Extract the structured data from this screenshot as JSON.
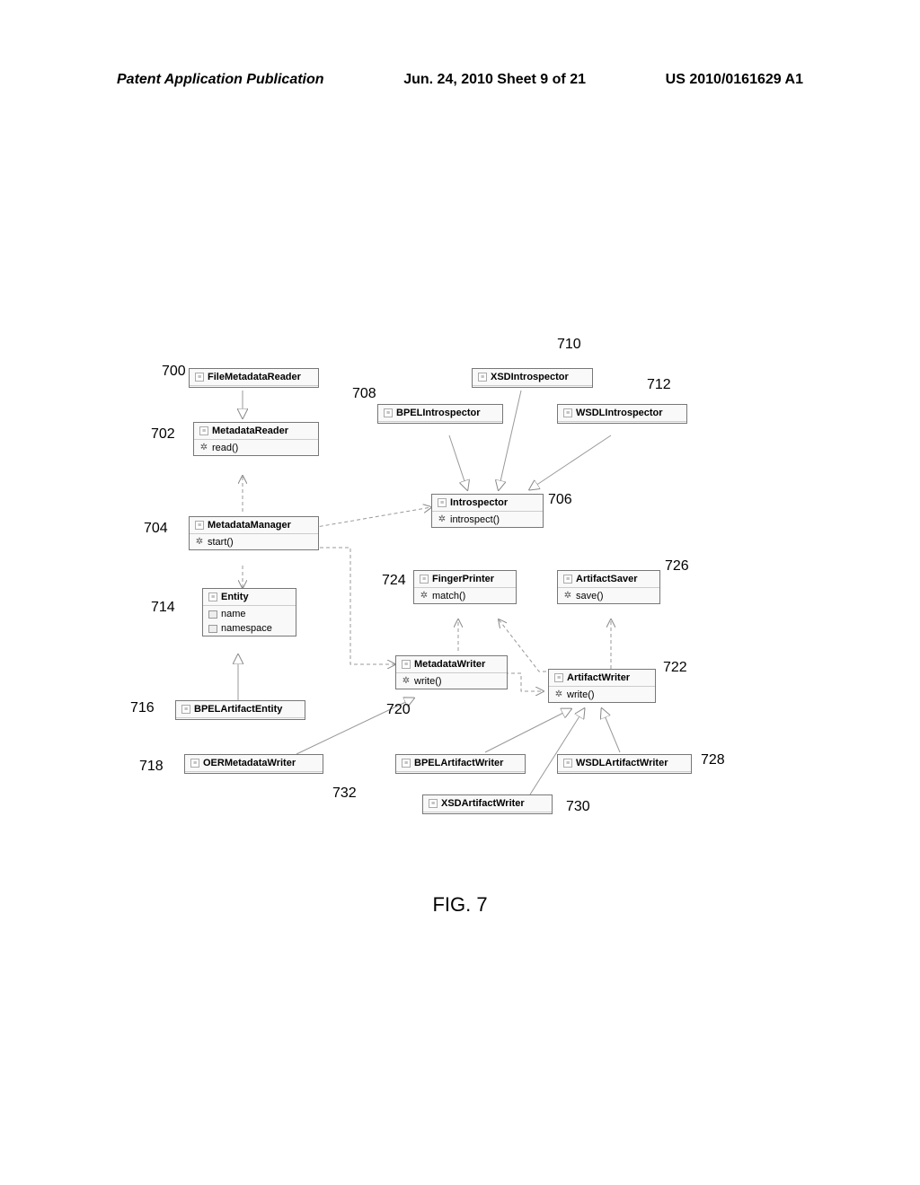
{
  "header": {
    "left": "Patent Application Publication",
    "center": "Jun. 24, 2010  Sheet 9 of 21",
    "right": "US 2010/0161629 A1"
  },
  "figure_caption": "FIG. 7",
  "nodes": {
    "n700": {
      "title": "FileMetadataReader",
      "ref": "700"
    },
    "n702": {
      "title": "MetadataReader",
      "method": "read()",
      "ref": "702"
    },
    "n704": {
      "title": "MetadataManager",
      "method": "start()",
      "ref": "704"
    },
    "n706": {
      "title": "Introspector",
      "method": "introspect()",
      "ref": "706"
    },
    "n708": {
      "title": "BPELIntrospector",
      "ref": "708"
    },
    "n710": {
      "title": "XSDIntrospector",
      "ref": "710"
    },
    "n712": {
      "title": "WSDLIntrospector",
      "ref": "712"
    },
    "n714": {
      "title": "Entity",
      "attr1": "name",
      "attr2": "namespace",
      "ref": "714"
    },
    "n716": {
      "title": "BPELArtifactEntity",
      "ref": "716"
    },
    "n718": {
      "title": "OERMetadataWriter",
      "ref": "718"
    },
    "n720": {
      "title": "MetadataWriter",
      "method": "write()",
      "ref": "720"
    },
    "n722": {
      "title": "ArtifactWriter",
      "method": "write()",
      "ref": "722"
    },
    "n724": {
      "title": "FingerPrinter",
      "method": "match()",
      "ref": "724"
    },
    "n726": {
      "title": "ArtifactSaver",
      "method": "save()",
      "ref": "726"
    },
    "n728": {
      "title": "WSDLArtifactWriter",
      "ref": "728"
    },
    "n730": {
      "title": "XSDArtifactWriter",
      "ref": "730"
    },
    "n732": {
      "title": "BPELArtifactWriter",
      "ref": "732"
    }
  }
}
